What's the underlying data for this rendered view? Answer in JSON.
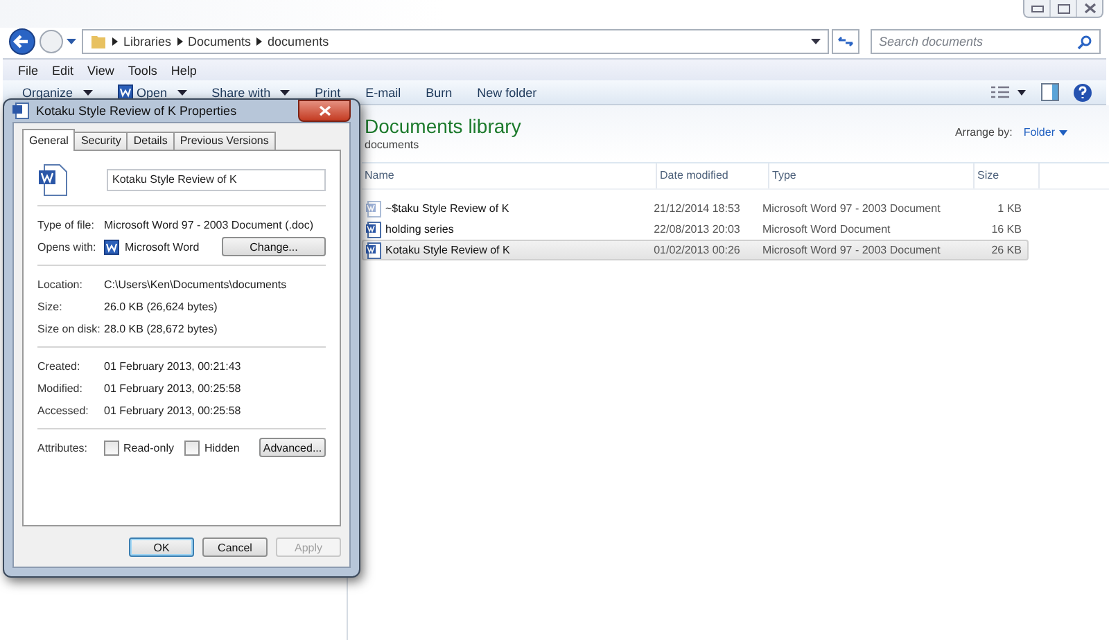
{
  "explorer": {
    "breadcrumb": [
      "Libraries",
      "Documents",
      "documents"
    ],
    "search": {
      "placeholder": "Search documents"
    },
    "menu": [
      "File",
      "Edit",
      "View",
      "Tools",
      "Help"
    ],
    "toolbar": [
      {
        "label": "Organize",
        "kind": "dropdown"
      },
      {
        "label": "Open",
        "kind": "word-dropdown"
      },
      {
        "label": "Share with",
        "kind": "dropdown"
      },
      {
        "label": "Print",
        "kind": "plain"
      },
      {
        "label": "E-mail",
        "kind": "plain"
      },
      {
        "label": "Burn",
        "kind": "plain"
      },
      {
        "label": "New folder",
        "kind": "plain"
      }
    ],
    "library": {
      "title": "Documents library",
      "subtitle": "documents",
      "arrange_label": "Arrange by:",
      "arrange_value": "Folder"
    },
    "columns": [
      "Name",
      "Date modified",
      "Type",
      "Size"
    ],
    "files": [
      {
        "name": "~$taku Style Review of K",
        "date": "21/12/2014 18:53",
        "type": "Microsoft Word 97 - 2003 Document",
        "size": "1 KB",
        "selected": false,
        "hidden_file": true
      },
      {
        "name": "holding series",
        "date": "22/08/2013 20:03",
        "type": "Microsoft Word Document",
        "size": "16 KB",
        "selected": false,
        "hidden_file": false
      },
      {
        "name": "Kotaku Style Review of K",
        "date": "01/02/2013 00:26",
        "type": "Microsoft Word 97 - 2003 Document",
        "size": "26 KB",
        "selected": true,
        "hidden_file": false
      }
    ]
  },
  "dialog": {
    "title": "Kotaku Style Review of K Properties",
    "tabs": [
      {
        "label": "General",
        "selected": true
      },
      {
        "label": "Security",
        "selected": false
      },
      {
        "label": "Details",
        "selected": false
      },
      {
        "label": "Previous Versions",
        "selected": false
      }
    ],
    "file_name": "Kotaku Style Review of K",
    "type_label": "Type of file:",
    "type_value": "Microsoft Word 97 - 2003 Document (.doc)",
    "opens_label": "Opens with:",
    "opens_value": "Microsoft Word",
    "change_button": "Change...",
    "location_rows": [
      {
        "label": "Location:",
        "value": "C:\\Users\\Ken\\Documents\\documents"
      },
      {
        "label": "Size:",
        "value": "26.0 KB (26,624 bytes)"
      },
      {
        "label": "Size on disk:",
        "value": "28.0 KB (28,672 bytes)"
      }
    ],
    "date_rows": [
      {
        "label": "Created:",
        "value": "01 February 2013, 00:21:43"
      },
      {
        "label": "Modified:",
        "value": "01 February 2013, 00:25:58"
      },
      {
        "label": "Accessed:",
        "value": "01 February 2013, 00:25:58"
      }
    ],
    "attributes_label": "Attributes:",
    "attributes": [
      {
        "label": "Read-only",
        "checked": false
      },
      {
        "label": "Hidden",
        "checked": false
      }
    ],
    "advanced_button": "Advanced...",
    "buttons": [
      {
        "label": "OK",
        "disabled": false,
        "default": true
      },
      {
        "label": "Cancel",
        "disabled": false,
        "default": false
      },
      {
        "label": "Apply",
        "disabled": true,
        "default": false
      }
    ]
  }
}
